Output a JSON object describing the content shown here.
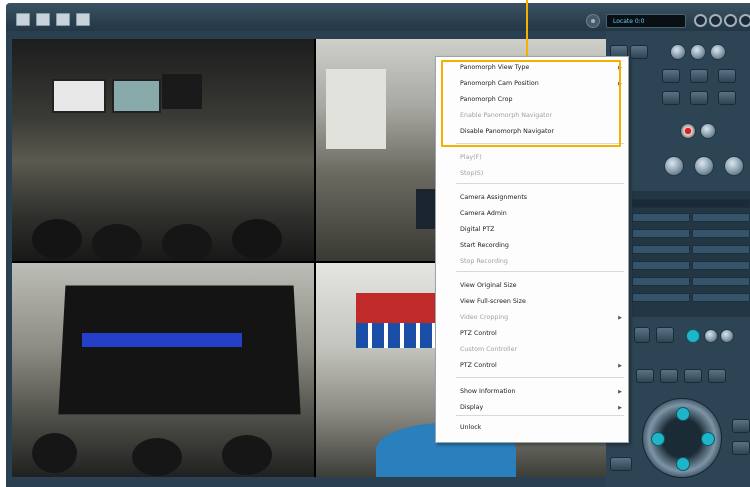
{
  "status_display": "Locate  0:0",
  "context_menu": {
    "items": [
      {
        "label": "Panomorph View Type",
        "has_submenu": true,
        "disabled": false
      },
      {
        "label": "Panomorph Cam Position",
        "has_submenu": true,
        "disabled": false
      },
      {
        "label": "Panomorph Crop",
        "has_submenu": false,
        "disabled": false
      },
      {
        "label": "Enable Panomorph Navigator",
        "has_submenu": false,
        "disabled": true
      },
      {
        "label": "Disable Panomorph Navigator",
        "has_submenu": false,
        "disabled": false
      },
      {
        "label": "Play(F)",
        "has_submenu": false,
        "disabled": true
      },
      {
        "label": "Stop(S)",
        "has_submenu": false,
        "disabled": true
      },
      {
        "label": "Camera Assignments",
        "has_submenu": false,
        "disabled": false
      },
      {
        "label": "Camera Admin",
        "has_submenu": false,
        "disabled": false
      },
      {
        "label": "Digital PTZ",
        "has_submenu": false,
        "disabled": false
      },
      {
        "label": "Start Recording",
        "has_submenu": false,
        "disabled": false
      },
      {
        "label": "Stop Recording",
        "has_submenu": false,
        "disabled": true
      },
      {
        "label": "View Original Size",
        "has_submenu": false,
        "disabled": false
      },
      {
        "label": "View Full-screen Size",
        "has_submenu": false,
        "disabled": false
      },
      {
        "label": "Video Cropping",
        "has_submenu": true,
        "disabled": true
      },
      {
        "label": "PTZ Control",
        "has_submenu": false,
        "disabled": false
      },
      {
        "label": "Custom Controller",
        "has_submenu": false,
        "disabled": true
      },
      {
        "label": "PTZ Control",
        "has_submenu": true,
        "disabled": false
      },
      {
        "label": "Show Information",
        "has_submenu": true,
        "disabled": false
      },
      {
        "label": "Display",
        "has_submenu": true,
        "disabled": false
      },
      {
        "label": "Unlock",
        "has_submenu": false,
        "disabled": false
      }
    ]
  },
  "colors": {
    "highlight": "#f5b000",
    "panel": "#2d4454",
    "accent": "#1fb4c8"
  },
  "icons": [
    "gear-icon",
    "submenu-arrow-icon",
    "record-icon",
    "joystick-icon"
  ]
}
